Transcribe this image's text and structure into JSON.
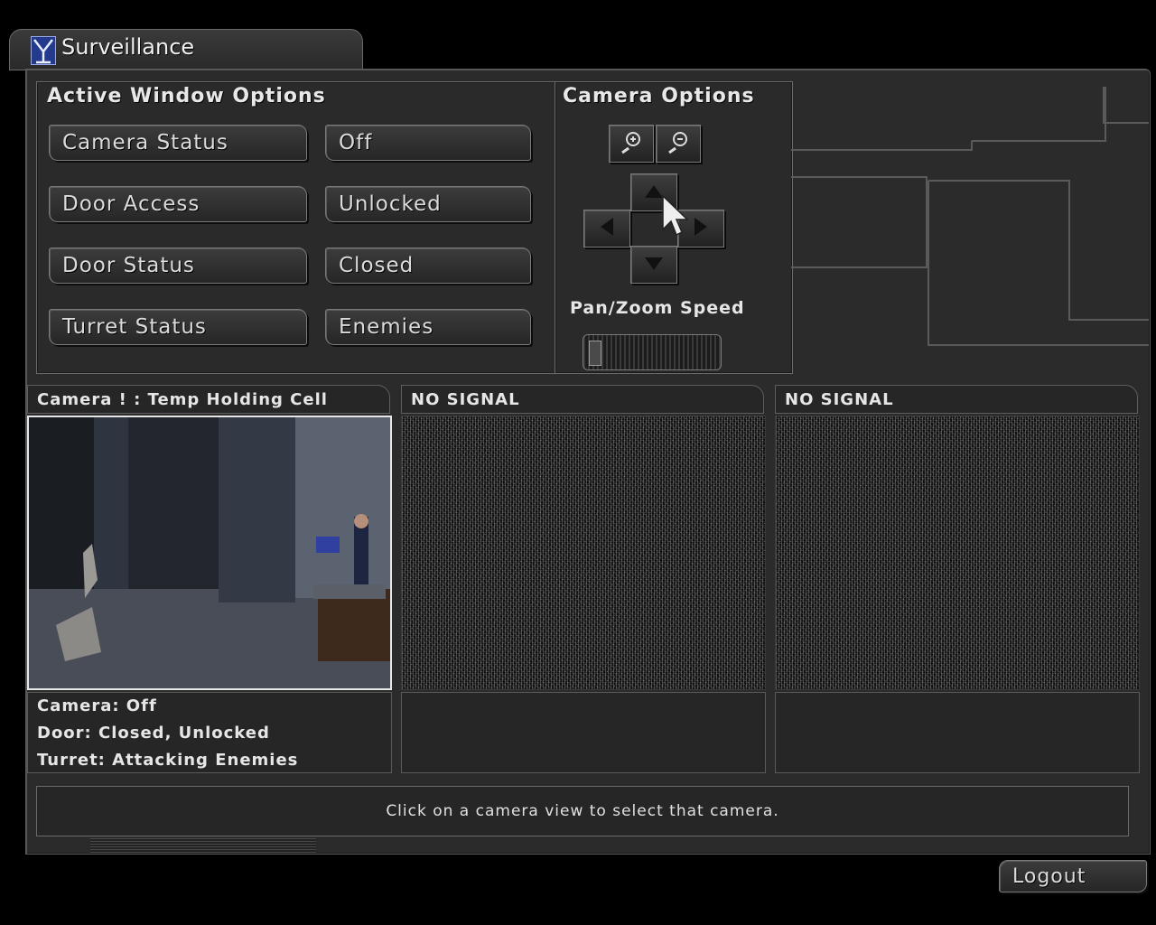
{
  "window": {
    "title": "Surveillance"
  },
  "active_window_options": {
    "header": "Active Window Options",
    "rows": [
      {
        "label": "Camera Status",
        "value": "Off"
      },
      {
        "label": "Door Access",
        "value": "Unlocked"
      },
      {
        "label": "Door Status",
        "value": "Closed"
      },
      {
        "label": "Turret Status",
        "value": "Enemies"
      }
    ]
  },
  "camera_options": {
    "header": "Camera Options",
    "speed_label": "Pan/Zoom Speed",
    "icons": {
      "zoom_in": "zoom-in-icon",
      "zoom_out": "zoom-out-icon",
      "up": "arrow-up-icon",
      "down": "arrow-down-icon",
      "left": "arrow-left-icon",
      "right": "arrow-right-icon"
    }
  },
  "cameras": [
    {
      "title": "Camera ! : Temp Holding Cell",
      "info": [
        "Camera: Off",
        "Door: Closed, Unlocked",
        "Turret: Attacking Enemies"
      ]
    },
    {
      "title": "NO SIGNAL",
      "info": []
    },
    {
      "title": "NO SIGNAL",
      "info": []
    }
  ],
  "status_message": "Click on a camera view to select that camera.",
  "logout_label": "Logout",
  "colors": {
    "panel": "#2b2b2b",
    "border": "#6a6a6a",
    "text": "#e6e6e6",
    "background": "#000000"
  }
}
